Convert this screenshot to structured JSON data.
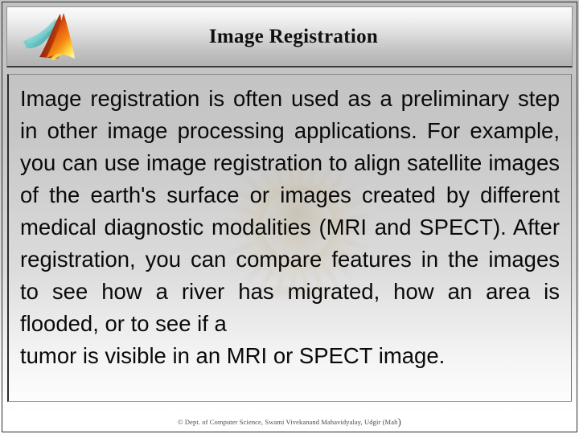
{
  "slide": {
    "header": {
      "title": "Image Registration",
      "logo_name": "matlab-logo-icon"
    },
    "body": {
      "paragraph_main": "Image registration is often used as a preliminary step in other image processing applications. For example, you can use image registration to align satellite images of the earth's surface or images created by different medical diagnostic modalities (MRI and SPECT). After registration, you can compare features in the images to see how a river has migrated, how an area is flooded, or to see if a",
      "paragraph_last_line": "tumor is visible in an MRI or SPECT image."
    },
    "footer": {
      "credit": "© Dept. of Computer Science, Swami Vivekanand Mahavidyalay, Udgir (Mah",
      "credit_tail": ")"
    },
    "colors": {
      "header_gradient_top": "#fbfbfb",
      "header_gradient_bottom": "#b2b2b2",
      "body_gradient_top": "#c2c2c2",
      "body_gradient_bottom": "#ffffff",
      "text": "#0a0a0a",
      "footer_text": "#4a4a52",
      "logo_orange": "#f47216",
      "logo_teal": "#62c6c6"
    }
  }
}
